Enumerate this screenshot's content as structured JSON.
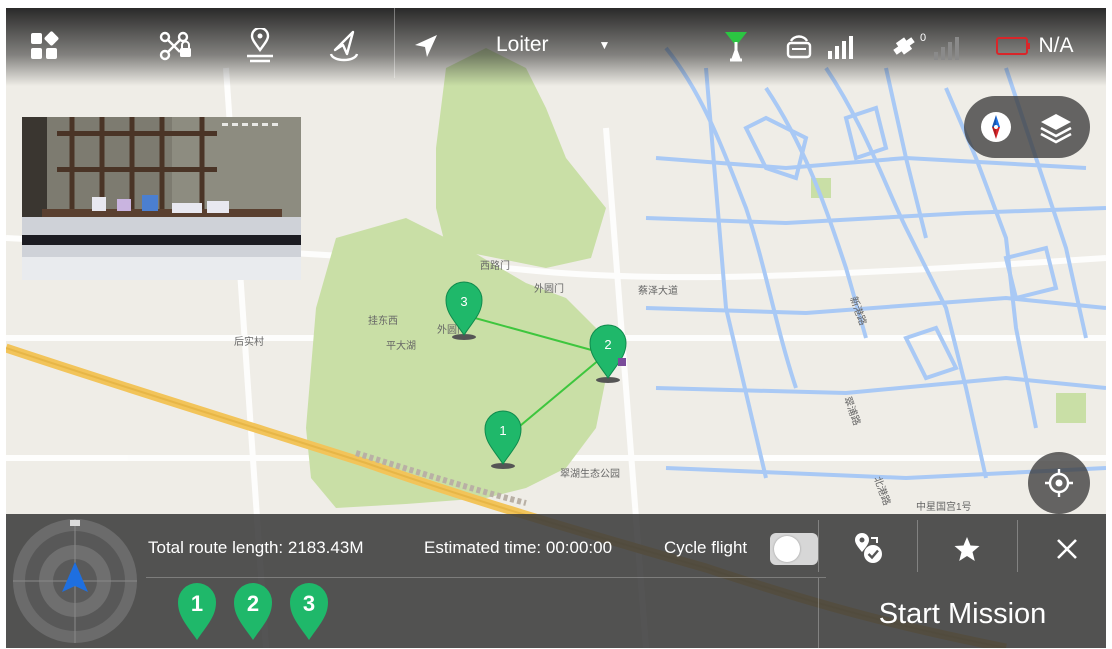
{
  "top_bar": {
    "flight_mode": "Loiter",
    "battery_text": "N/A",
    "satellite_count": "0"
  },
  "map": {
    "waypoints": [
      "1",
      "2",
      "3"
    ],
    "route_color": "#3ec63e",
    "park_color": "#c9dfa6",
    "water_color": "#a9c9f5",
    "road_color": "#f2c45a",
    "labels": [
      "西路门",
      "外圆门",
      "蔡泽大道",
      "挂东西",
      "外圆门",
      "平大湖",
      "后实村",
      "新港路",
      "翠浦路",
      "翠湖生态公园",
      "中星国宫1号",
      "北港路"
    ]
  },
  "route_panel": {
    "total_route_length": "Total route length: 2183.43M",
    "estimated_time": "Estimated time: 00:00:00",
    "cycle_flight_label": "Cycle flight",
    "cycle_flight_on": false,
    "waypoint_chips": [
      "1",
      "2",
      "3"
    ],
    "start_mission_label": "Start Mission"
  },
  "colors": {
    "waypoint_green": "#1fb86a",
    "battery_red": "#d9262a",
    "gps_green": "#2bc542",
    "heading_blue": "#1e6fe0"
  }
}
